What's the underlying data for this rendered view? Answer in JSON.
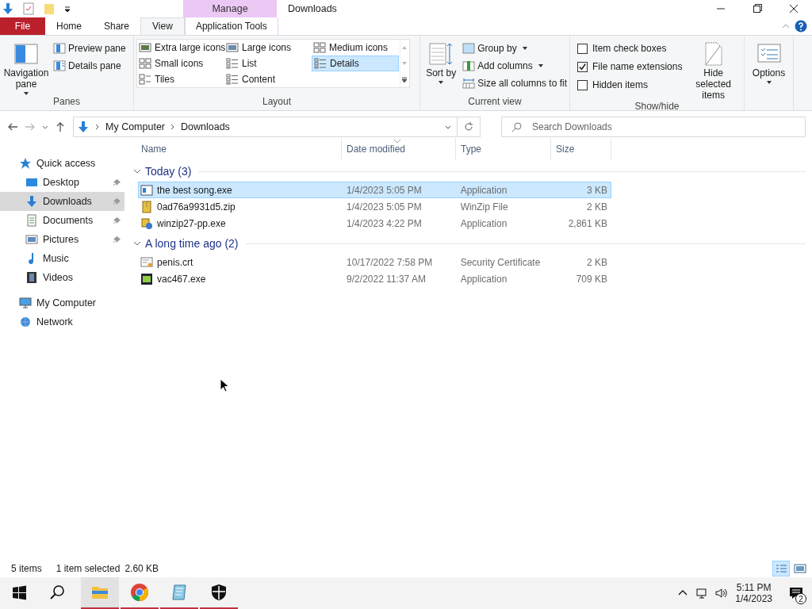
{
  "window": {
    "title": "Downloads",
    "context_group": "Manage"
  },
  "ribbon_tabs": [
    {
      "label": "File",
      "kind": "file",
      "selected": false
    },
    {
      "label": "Home",
      "kind": "normal",
      "selected": false
    },
    {
      "label": "Share",
      "kind": "normal",
      "selected": false
    },
    {
      "label": "View",
      "kind": "normal",
      "selected": true
    },
    {
      "label": "Application Tools",
      "kind": "context",
      "selected": false
    }
  ],
  "panes": {
    "label": "Panes",
    "navigation_pane": "Navigation pane",
    "preview_pane": "Preview pane",
    "details_pane": "Details pane"
  },
  "layout": {
    "label": "Layout",
    "options": [
      {
        "label": "Extra large icons",
        "kind": "xl",
        "selected": false
      },
      {
        "label": "Large icons",
        "kind": "large",
        "selected": false
      },
      {
        "label": "Medium icons",
        "kind": "medium",
        "selected": false
      },
      {
        "label": "Small icons",
        "kind": "small",
        "selected": false
      },
      {
        "label": "List",
        "kind": "list",
        "selected": false
      },
      {
        "label": "Details",
        "kind": "details",
        "selected": true
      },
      {
        "label": "Tiles",
        "kind": "tiles",
        "selected": false
      },
      {
        "label": "Content",
        "kind": "content",
        "selected": false
      }
    ]
  },
  "current_view": {
    "label": "Current view",
    "sort_by": "Sort by",
    "group_by": "Group by",
    "add_columns": "Add columns",
    "size_columns": "Size all columns to fit"
  },
  "show_hide": {
    "label": "Show/hide",
    "checkboxes": [
      {
        "label": "Item check boxes",
        "checked": false
      },
      {
        "label": "File name extensions",
        "checked": true
      },
      {
        "label": "Hidden items",
        "checked": false
      }
    ],
    "hide_selected": "Hide selected items"
  },
  "options": {
    "label": "Options"
  },
  "address": {
    "path": [
      "My Computer",
      "Downloads"
    ],
    "search_placeholder": "Search Downloads"
  },
  "navigation": [
    {
      "label": "Quick access",
      "kind": "star",
      "selected": false,
      "children": [
        {
          "label": "Desktop",
          "kind": "desktop",
          "selected": false,
          "pinned": true
        },
        {
          "label": "Downloads",
          "kind": "download",
          "selected": true,
          "pinned": true
        },
        {
          "label": "Documents",
          "kind": "documents",
          "selected": false,
          "pinned": true
        },
        {
          "label": "Pictures",
          "kind": "pictures",
          "selected": false,
          "pinned": true
        },
        {
          "label": "Music",
          "kind": "music",
          "selected": false,
          "pinned": false
        },
        {
          "label": "Videos",
          "kind": "videos",
          "selected": false,
          "pinned": false
        }
      ]
    },
    {
      "label": "My Computer",
      "kind": "computer",
      "selected": false
    },
    {
      "label": "Network",
      "kind": "network",
      "selected": false
    }
  ],
  "columns": [
    "Name",
    "Date modified",
    "Type",
    "Size"
  ],
  "groups": [
    {
      "label": "Today (3)",
      "expanded": true,
      "rows": [
        {
          "name": "the best song.exe",
          "kind": "window",
          "date": "1/4/2023 5:05 PM",
          "type": "Application",
          "size": "3 KB",
          "selected": true
        },
        {
          "name": "0ad76a9931d5.zip",
          "kind": "zip",
          "date": "1/4/2023 5:05 PM",
          "type": "WinZip File",
          "size": "2 KB",
          "selected": false
        },
        {
          "name": "winzip27-pp.exe",
          "kind": "installer",
          "date": "1/4/2023 4:22 PM",
          "type": "Application",
          "size": "2,861 KB",
          "selected": false
        }
      ]
    },
    {
      "label": "A long time ago (2)",
      "expanded": true,
      "rows": [
        {
          "name": "penis.crt",
          "kind": "certificate",
          "date": "10/17/2022 7:58 PM",
          "type": "Security Certificate",
          "size": "2 KB",
          "selected": false
        },
        {
          "name": "vac467.exe",
          "kind": "program",
          "date": "9/2/2022 11:37 AM",
          "type": "Application",
          "size": "709 KB",
          "selected": false
        }
      ]
    }
  ],
  "status_bar": {
    "count": "5 items",
    "selection": "1 item selected",
    "selection_size": "2.60 KB",
    "view_buttons": [
      {
        "kind": "details",
        "selected": true
      },
      {
        "kind": "large",
        "selected": false
      }
    ]
  },
  "taskbar": {
    "apps": [
      {
        "kind": "explorer",
        "running": true,
        "active": true
      },
      {
        "kind": "chrome",
        "running": true,
        "active": false
      },
      {
        "kind": "notepad",
        "running": true,
        "active": false
      },
      {
        "kind": "shield",
        "running": true,
        "active": false
      }
    ],
    "time": "5:11 PM",
    "date": "1/4/2023",
    "notifications": "2"
  }
}
